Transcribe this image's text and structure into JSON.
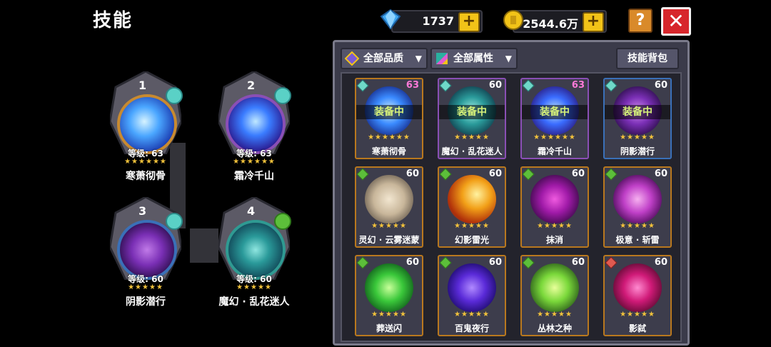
{
  "header": {
    "title": "技能"
  },
  "currency": {
    "gems": "1737",
    "gold": "2544.6万",
    "plus_symbol": "+"
  },
  "buttons": {
    "help": "?",
    "close": "✕"
  },
  "slots": [
    {
      "num": "1",
      "level": "等级: 63",
      "stars": "★★★★★★",
      "name": "寒萧彻骨"
    },
    {
      "num": "2",
      "level": "等级: 63",
      "stars": "★★★★★★",
      "name": "霜冷千山"
    },
    {
      "num": "3",
      "level": "等级: 60",
      "stars": "★★★★★",
      "name": "阴影潜行"
    },
    {
      "num": "4",
      "level": "等级: 60",
      "stars": "★★★★★",
      "name": "魔幻 · 乱花迷人"
    }
  ],
  "filters": {
    "quality": "全部品质",
    "attribute": "全部属性",
    "bag": "技能背包",
    "arrow": "▼"
  },
  "cards": [
    {
      "level": "63",
      "equipped": "装备中",
      "stars": "★★★★★★",
      "name": "寒萧彻骨"
    },
    {
      "level": "60",
      "equipped": "装备中",
      "stars": "★★★★★",
      "name": "魔幻 · 乱花迷人"
    },
    {
      "level": "63",
      "equipped": "装备中",
      "stars": "★★★★★★",
      "name": "霜冷千山"
    },
    {
      "level": "60",
      "equipped": "装备中",
      "stars": "★★★★★",
      "name": "阴影潜行"
    },
    {
      "level": "60",
      "stars": "★★★★★",
      "name": "灵幻 · 云雾迷蒙"
    },
    {
      "level": "60",
      "stars": "★★★★★",
      "name": "幻影雷光"
    },
    {
      "level": "60",
      "stars": "★★★★★",
      "name": "抹消"
    },
    {
      "level": "60",
      "stars": "★★★★★",
      "name": "极意 · 斩雷"
    },
    {
      "level": "60",
      "stars": "★★★★★",
      "name": "葬送闪"
    },
    {
      "level": "60",
      "stars": "★★★★★",
      "name": "百鬼夜行"
    },
    {
      "level": "60",
      "stars": "★★★★★",
      "name": "丛林之种"
    },
    {
      "level": "60",
      "stars": "★★★★★",
      "name": "影弑"
    }
  ]
}
